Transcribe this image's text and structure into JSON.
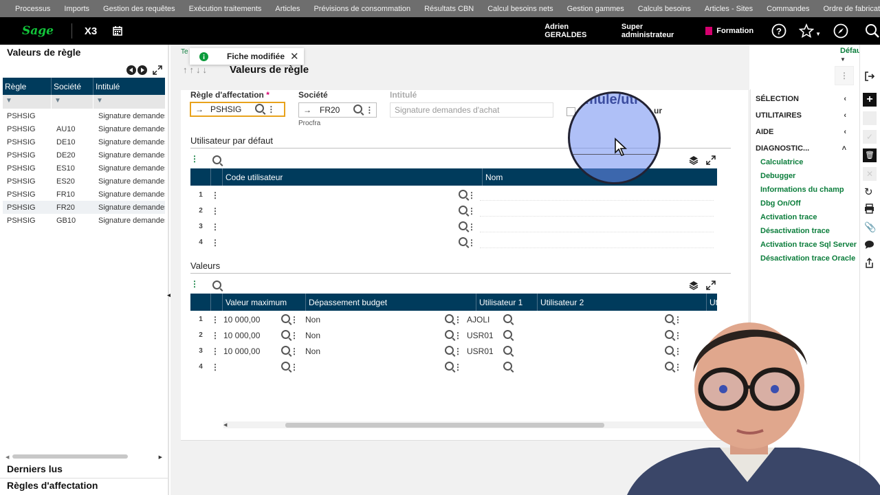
{
  "top_menu": [
    "Processus",
    "Imports",
    "Gestion des requêtes",
    "Exécution traitements",
    "Articles",
    "Prévisions de consommation",
    "Résultats CBN",
    "Calcul besoins nets",
    "Gestion gammes",
    "Calculs besoins",
    "Articles - Sites",
    "Commandes",
    "Ordre de fabrication"
  ],
  "navbar": {
    "logo": "Sage",
    "product": "X3",
    "user": "Adrien GERALDES",
    "role": "Super administrateur",
    "folder": "Formation",
    "folder_color": "#d4006e"
  },
  "left": {
    "title": "Valeurs de règle",
    "columns": [
      "Règle",
      "Société",
      "Intitulé"
    ],
    "rows": [
      {
        "rule": "PSHSIG",
        "company": "",
        "label": "Signature demandes"
      },
      {
        "rule": "PSHSIG",
        "company": "AU10",
        "label": "Signature demandes"
      },
      {
        "rule": "PSHSIG",
        "company": "DE10",
        "label": "Signature demandes"
      },
      {
        "rule": "PSHSIG",
        "company": "DE20",
        "label": "Signature demandes"
      },
      {
        "rule": "PSHSIG",
        "company": "ES10",
        "label": "Signature demandes"
      },
      {
        "rule": "PSHSIG",
        "company": "ES20",
        "label": "Signature demandes"
      },
      {
        "rule": "PSHSIG",
        "company": "FR10",
        "label": "Signature demandes"
      },
      {
        "rule": "PSHSIG",
        "company": "FR20",
        "label": "Signature demandes"
      },
      {
        "rule": "PSHSIG",
        "company": "GB10",
        "label": "Signature demandes"
      }
    ],
    "footer1": "Derniers lus",
    "footer2": "Règles d'affectation"
  },
  "main": {
    "breadcrumb": "Te",
    "title": "Valeurs de règle",
    "default_label": "Défaut",
    "toast": "Fiche modifiée",
    "field_rule_label": "Règle d'affectation",
    "field_rule_required": "*",
    "field_rule_value": "PSHSIG",
    "field_company_label": "Société",
    "field_company_value": "FR20",
    "field_company_desc": "Procfra",
    "field_title_label": "Intitulé",
    "field_title_placeholder": "Signature demandes d'achat",
    "lens_text": "mule/uti",
    "checkbox_label_partial": "ur",
    "section_users": "Utilisateur par défaut",
    "users_columns": [
      "Code utilisateur",
      "Nom"
    ],
    "users_rows": [
      "1",
      "2",
      "3",
      "4"
    ],
    "section_values": "Valeurs",
    "values_columns": [
      "Valeur maximum",
      "Dépassement budget",
      "Utilisateur 1",
      "Utilisateur 2",
      "Ut"
    ],
    "values_rows": [
      {
        "n": "1",
        "max": "10 000,00",
        "budget": "Non",
        "user1": "AJOLI"
      },
      {
        "n": "2",
        "max": "10 000,00",
        "budget": "Non",
        "user1": "USR01"
      },
      {
        "n": "3",
        "max": "10 000,00",
        "budget": "Non",
        "user1": "USR01"
      },
      {
        "n": "4",
        "max": "",
        "budget": "",
        "user1": ""
      }
    ]
  },
  "right": {
    "sections": [
      "SÉLECTION",
      "UTILITAIRES",
      "AIDE",
      "DIAGNOSTIC..."
    ],
    "diagnostic_links": [
      "Calculatrice",
      "Debugger",
      "Informations du champ",
      "Dbg On/Off",
      "Activation trace",
      "Désactivation trace",
      "Activation trace Sql Server",
      "Désactivation trace Oracle"
    ]
  },
  "colors": {
    "header": "#003b5c",
    "link": "#0b7d3b",
    "accent": "#12c43a"
  }
}
